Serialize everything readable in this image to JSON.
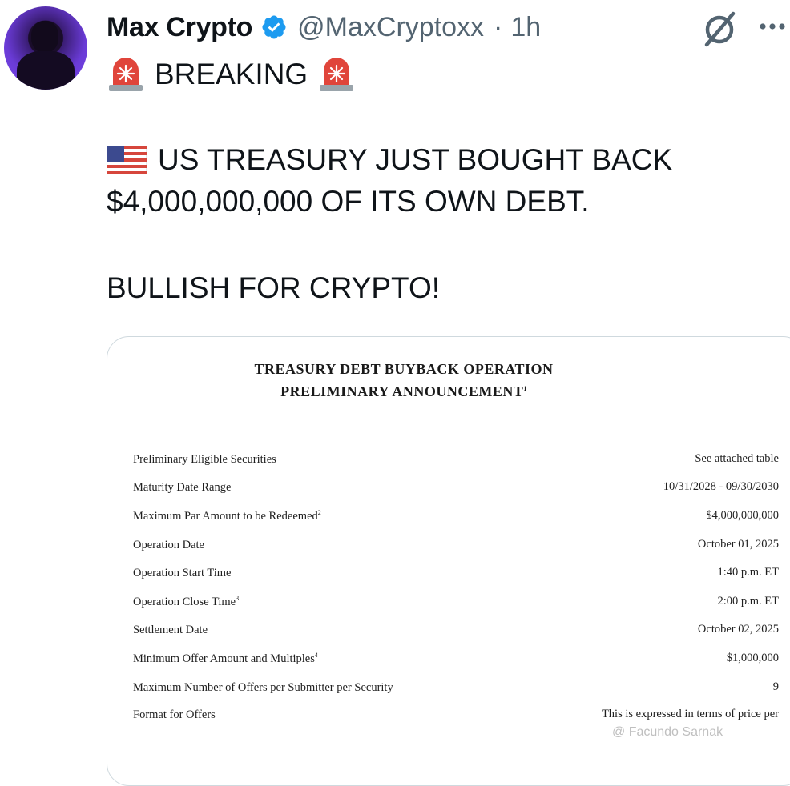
{
  "tweet": {
    "author_name": "Max Crypto",
    "handle": "@MaxCryptoxx",
    "separator": "·",
    "time": "1h",
    "line_breaking": "BREAKING",
    "line1": "US TREASURY JUST BOUGHT BACK",
    "line2": "$4,000,000,000 OF ITS OWN DEBT.",
    "line3": "BULLISH FOR CRYPTO!"
  },
  "icons": {
    "verified": "verified-badge-icon",
    "grok": "grok-icon",
    "more": "more-options-icon",
    "siren": "police-light-emoji",
    "flag": "us-flag-emoji"
  },
  "colors": {
    "verified_blue": "#1d9bf0",
    "text": "#0f1419",
    "secondary": "#536471",
    "siren_red": "#e0453b",
    "avatar_purple": "#6a3bd6"
  },
  "document": {
    "title_line1": "TREASURY DEBT BUYBACK OPERATION",
    "title_line2": "PRELIMINARY ANNOUNCEMENT",
    "title_sup": "1",
    "rows": [
      {
        "label": "Preliminary Eligible Securities",
        "sup": "",
        "value": "See attached table"
      },
      {
        "label": "Maturity Date Range",
        "sup": "",
        "value": "10/31/2028 - 09/30/2030"
      },
      {
        "label": "Maximum Par Amount to be Redeemed",
        "sup": "2",
        "value": "$4,000,000,000"
      },
      {
        "label": "Operation Date",
        "sup": "",
        "value": "October 01, 2025"
      },
      {
        "label": "Operation Start Time",
        "sup": "",
        "value": "1:40 p.m. ET"
      },
      {
        "label": "Operation Close Time",
        "sup": "3",
        "value": "2:00 p.m. ET"
      },
      {
        "label": "Settlement Date",
        "sup": "",
        "value": "October 02, 2025"
      },
      {
        "label": "Minimum Offer Amount and Multiples",
        "sup": "4",
        "value": "$1,000,000"
      },
      {
        "label": "Maximum Number of Offers per Submitter per Security",
        "sup": "",
        "value": "9"
      },
      {
        "label": "Format for Offers",
        "sup": "",
        "value": "This is expressed in terms of price per"
      }
    ]
  },
  "watermark": "@ Facundo Sarnak"
}
